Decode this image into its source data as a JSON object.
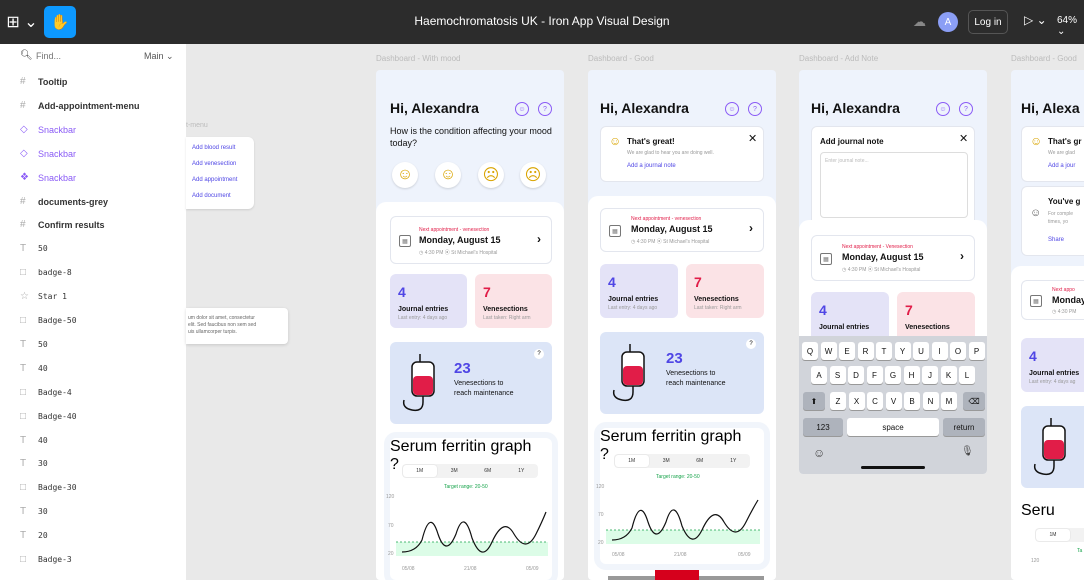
{
  "topbar": {
    "logo": "⊞ ⌄",
    "hand_icon": "✋",
    "title": "Haemochromatosis UK - Iron App Visual Design",
    "avatar": "A",
    "login": "Log in",
    "play": "▷ ⌄",
    "zoom": "64% ⌄"
  },
  "layers": {
    "search_placeholder": "Find...",
    "page": "Main ⌄",
    "items": [
      {
        "icon": "#",
        "label": "Tooltip"
      },
      {
        "icon": "#",
        "label": "Add-appointment-menu"
      },
      {
        "icon": "◇",
        "label": "Snackbar"
      },
      {
        "icon": "◇",
        "label": "Snackbar"
      },
      {
        "icon": "❖",
        "label": "Snackbar"
      },
      {
        "icon": "#",
        "label": "documents-grey"
      },
      {
        "icon": "#",
        "label": "Confirm results"
      },
      {
        "icon": "T",
        "label": "50"
      },
      {
        "icon": "□",
        "label": "badge-8"
      },
      {
        "icon": "☆",
        "label": "Star 1"
      },
      {
        "icon": "□",
        "label": "Badge-50"
      },
      {
        "icon": "T",
        "label": "50"
      },
      {
        "icon": "T",
        "label": "40"
      },
      {
        "icon": "□",
        "label": "Badge-4"
      },
      {
        "icon": "□",
        "label": "Badge-40"
      },
      {
        "icon": "T",
        "label": "40"
      },
      {
        "icon": "T",
        "label": "30"
      },
      {
        "icon": "□",
        "label": "Badge-30"
      },
      {
        "icon": "T",
        "label": "30"
      },
      {
        "icon": "T",
        "label": "20"
      },
      {
        "icon": "□",
        "label": "Badge-3"
      }
    ]
  },
  "canvas": {
    "frame_labels": [
      "Dashboard - With mood",
      "Dashboard - Good",
      "Dashboard - Add Note",
      "Dashboard - Good"
    ],
    "menu_fragment": {
      "label": "t-menu",
      "items": [
        "Add blood result",
        "Add venesection",
        "Add appointment",
        "Add document"
      ]
    },
    "tooltip_fragment": "um dolor sit amet, consectetur\nelit. Sed faucibus non sem sed\nuis ullamcorper turpis.",
    "greeting": "Hi, Alexandra",
    "greeting_cut": "Hi, Alexa",
    "mood_question": "How is the condition affecting your mood today?",
    "appointment": {
      "kicker": "Next appointment - venesection",
      "kicker_alt": "Next appointment - Venesection",
      "kicker_cut": "Next appo",
      "date": "Monday, August 15",
      "date_cut": "Monday",
      "meta": "◷ 4:30 PM   ⦿ St Michael's Hospital",
      "meta_cut": "◷ 4:30 PM"
    },
    "stats": {
      "journal_num": "4",
      "journal_label": "Journal entries",
      "journal_label_cut": "Journal entries",
      "journal_sub": "Last entry: 4 days ago",
      "journal_sub_cut": "Last entry: 4 days ag",
      "vene_num": "7",
      "vene_label": "Venesections",
      "vene_sub": "Last taken: Right arm"
    },
    "maintenance": {
      "num": "23",
      "line1": "Venesections to",
      "line2": "reach maintenance",
      "help": "?"
    },
    "graph": {
      "title": "Serum ferritin graph",
      "help": "?",
      "ranges": [
        "1M",
        "3M",
        "6M",
        "1Y"
      ],
      "ranges_cut": [
        "1M"
      ],
      "target": "Target range: 20-50",
      "target_cut": "Ta",
      "y_ticks": [
        "120",
        "70",
        "20"
      ],
      "y_tick_cut": "120",
      "x_ticks": [
        "05/08",
        "21/08",
        "05/09"
      ],
      "title_cut": "Seru"
    },
    "toast": {
      "title": "That's great!",
      "title_cut": "That's gr",
      "sub": "We are glad to hear you are doing well.",
      "sub_cut": "We are glad",
      "link": "Add a journal note",
      "link_cut": "Add a jour"
    },
    "share_card": {
      "title": "You've g",
      "sub1": "For comple",
      "sub2": "times, yo",
      "share": "Share"
    },
    "note": {
      "title": "Add journal note",
      "placeholder": "Enter journal note..."
    },
    "keyboard": {
      "row1": [
        "Q",
        "W",
        "E",
        "R",
        "T",
        "Y",
        "U",
        "I",
        "O",
        "P"
      ],
      "row2": [
        "A",
        "S",
        "D",
        "F",
        "G",
        "H",
        "J",
        "K",
        "L"
      ],
      "row3": [
        "Z",
        "X",
        "C",
        "V",
        "B",
        "N",
        "M"
      ],
      "shift": "⬆",
      "delete": "⌫",
      "num": "123",
      "space": "space",
      "return": "return",
      "emoji": "☺",
      "mic": "🎙"
    }
  }
}
